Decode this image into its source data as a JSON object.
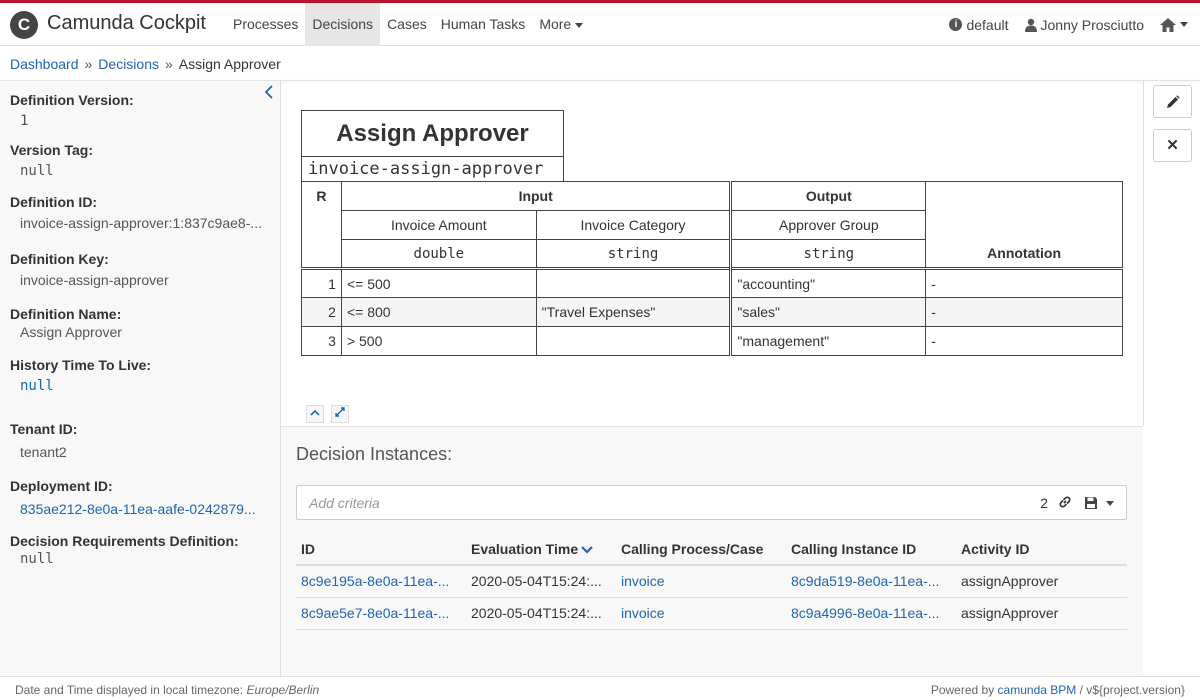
{
  "header": {
    "logo": "C",
    "brand": "Camunda Cockpit",
    "nav": [
      "Processes",
      "Decisions",
      "Cases",
      "Human Tasks",
      "More"
    ],
    "active_nav": "Decisions",
    "engine": "default",
    "user": "Jonny Prosciutto"
  },
  "breadcrumb": {
    "items": [
      "Dashboard",
      "Decisions",
      "Assign Approver"
    ],
    "separator": "»"
  },
  "sidebar": {
    "props": [
      {
        "label": "Definition Version:",
        "value": "1"
      },
      {
        "label": "Version Tag:",
        "value": "null"
      },
      {
        "label": "Definition ID:",
        "value": "invoice-assign-approver:1:837c9ae8-..."
      },
      {
        "label": "Definition Key:",
        "value": "invoice-assign-approver"
      },
      {
        "label": "Definition Name:",
        "value": "Assign Approver"
      },
      {
        "label": "History Time To Live:",
        "value": "null"
      },
      {
        "label": "Tenant ID:",
        "value": "tenant2"
      },
      {
        "label": "Deployment ID:",
        "value": "835ae212-8e0a-11ea-aafe-0242879..."
      },
      {
        "label": "Decision Requirements Definition:",
        "value": "null"
      }
    ]
  },
  "dmn": {
    "title": "Assign Approver",
    "id": "invoice-assign-approver",
    "hit_policy": "R",
    "input_header": "Input",
    "output_header": "Output",
    "annotation_header": "Annotation",
    "inputs": [
      {
        "label": "Invoice Amount",
        "type": "double"
      },
      {
        "label": "Invoice Category",
        "type": "string"
      }
    ],
    "outputs": [
      {
        "label": "Approver Group",
        "type": "string"
      }
    ],
    "rules": [
      {
        "n": "1",
        "amount": "<= 500",
        "category": "",
        "group": "\"accounting\"",
        "annotation": "-"
      },
      {
        "n": "2",
        "amount": "<= 800",
        "category": "\"Travel Expenses\"",
        "group": "\"sales\"",
        "annotation": "-"
      },
      {
        "n": "3",
        "amount": "> 500",
        "category": "",
        "group": "\"management\"",
        "annotation": "-"
      }
    ]
  },
  "instances": {
    "title": "Decision Instances:",
    "search_placeholder": "Add criteria",
    "count": "2",
    "columns": [
      "ID",
      "Evaluation Time",
      "Calling Process/Case",
      "Calling Instance ID",
      "Activity ID"
    ],
    "rows": [
      {
        "id": "8c9e195a-8e0a-11ea-...",
        "time": "2020-05-04T15:24:...",
        "process": "invoice",
        "instance": "8c9da519-8e0a-11ea-...",
        "activity": "assignApprover"
      },
      {
        "id": "8c9ae5e7-8e0a-11ea-...",
        "time": "2020-05-04T15:24:...",
        "process": "invoice",
        "instance": "8c9a4996-8e0a-11ea-...",
        "activity": "assignApprover"
      }
    ]
  },
  "footer": {
    "tz_prefix": "Date and Time displayed in local timezone:",
    "tz": "Europe/Berlin",
    "powered_prefix": "Powered by",
    "powered_link": "camunda BPM",
    "version": "/ v${project.version}"
  },
  "colors": {
    "brand_red": "#b5152b",
    "link": "#1f64b0"
  }
}
